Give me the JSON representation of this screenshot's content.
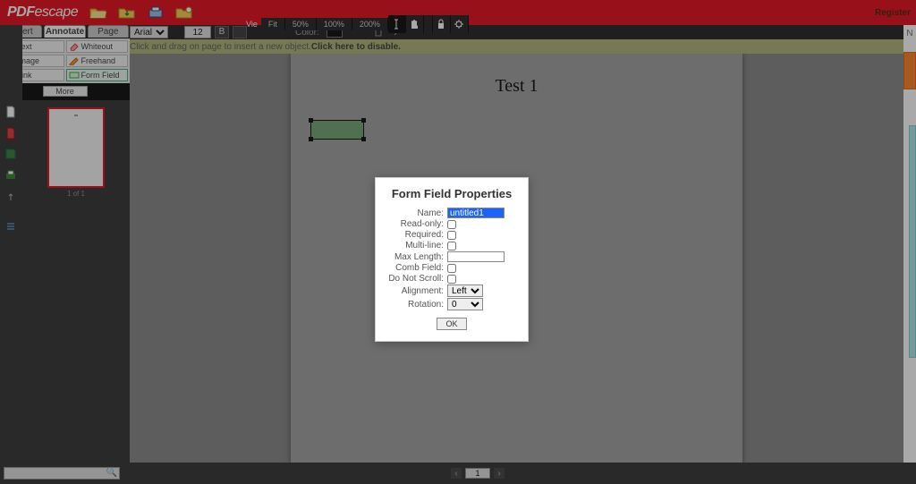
{
  "header": {
    "logo_pdf": "PDF",
    "logo_escape": "escape",
    "register": "Register",
    "zoom_label": "Vie",
    "zoom": [
      "Fit",
      "50%",
      "100%",
      "200%"
    ]
  },
  "fmt": {
    "font": "Arial",
    "size": "12",
    "bold": "B",
    "color_label": "Color:"
  },
  "hint": {
    "text": "Click and drag on page to insert a new object. ",
    "bold": "Click here to disable."
  },
  "tabs": [
    "Insert",
    "Annotate",
    "Page"
  ],
  "tools": [
    {
      "icon": "T",
      "label": "Text"
    },
    {
      "icon": "wo",
      "label": "Whiteout"
    },
    {
      "icon": "img",
      "label": "Image"
    },
    {
      "icon": "fh",
      "label": "Freehand"
    },
    {
      "icon": "lnk",
      "label": "Link"
    },
    {
      "icon": "ff",
      "label": "Form Field"
    }
  ],
  "more": "More",
  "thumb_caption": "1 of 1",
  "doc": {
    "title": "Test 1"
  },
  "rstrip": {
    "letter": "N"
  },
  "bottom": {
    "page": "1"
  },
  "dialog": {
    "title": "Form Field Properties",
    "labels": {
      "name": "Name:",
      "readonly": "Read-only:",
      "required": "Required:",
      "multiline": "Multi-line:",
      "maxlength": "Max Length:",
      "comb": "Comb Field:",
      "noscroll": "Do Not Scroll:",
      "align": "Alignment:",
      "rotation": "Rotation:"
    },
    "values": {
      "name": "untitled1",
      "maxlength": "",
      "align": "Left",
      "rotation": "0"
    },
    "ok": "OK"
  }
}
